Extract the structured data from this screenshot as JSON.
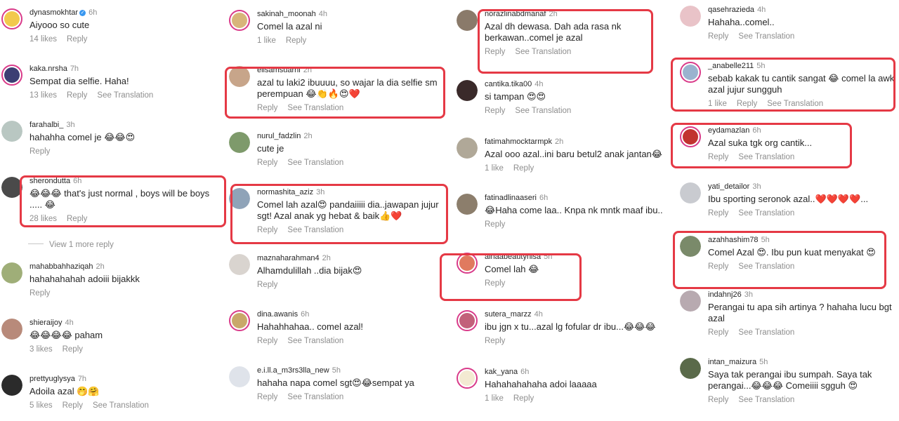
{
  "ui": {
    "reply": "Reply",
    "see_translation": "See Translation",
    "view_more": "View 1 more reply"
  },
  "columns": [
    [
      {
        "user": "dynasmokhtar",
        "time": "6h",
        "verified": true,
        "text": "Aiyooo so cute",
        "likes": "14 likes",
        "translate": false,
        "ring": true,
        "avatar": "#f2c94c"
      },
      {
        "user": "kaka.nrsha",
        "time": "7h",
        "text": "Sempat dia selfie. Haha!",
        "likes": "13 likes",
        "translate": true,
        "ring": true,
        "avatar": "#3c3f73"
      },
      {
        "user": "farahalbi_",
        "time": "3h",
        "text": "hahahha comel je 😂😂😍",
        "likes": "",
        "translate": false,
        "ring": false,
        "avatar": "#b9c7c2"
      },
      {
        "user": "sherondutta",
        "time": "6h",
        "text": "😂😂😂 that's just normal , boys will be boys\n..... 😂",
        "likes": "28 likes",
        "translate": false,
        "ring": false,
        "avatar": "#4a4a4a",
        "highlight": true
      },
      {
        "user": "mahabbahhaziqah",
        "time": "2h",
        "text": "hahahahahah adoiii bijakkk",
        "likes": "",
        "translate": false,
        "ring": false,
        "avatar": "#9fae78"
      },
      {
        "user": "shieraijoy",
        "time": "4h",
        "text": "😂😂😂😂 paham",
        "likes": "3 likes",
        "translate": false,
        "ring": false,
        "avatar": "#b88a7a"
      },
      {
        "user": "prettyuglysya",
        "time": "7h",
        "text": "Adoila azal 🤭🤗",
        "likes": "5 likes",
        "translate": true,
        "ring": false,
        "avatar": "#2b2b2b"
      }
    ],
    [
      {
        "user": "sakinah_moonah",
        "time": "4h",
        "text": "Comel la azal ni",
        "likes": "1 like",
        "translate": false,
        "ring": true,
        "avatar": "#d8b57a"
      },
      {
        "user": "elisamsuarni",
        "time": "2h",
        "text": "azal tu laki2 ibuuuu, so wajar la dia selfie sm\nperempuan 😂👏🔥😍❤️",
        "likes": "",
        "translate": true,
        "ring": false,
        "avatar": "#c7a58a",
        "highlight": true
      },
      {
        "user": "nurul_fadzlin",
        "time": "2h",
        "text": "cute je",
        "likes": "",
        "translate": true,
        "ring": false,
        "avatar": "#7e9a6b"
      },
      {
        "user": "normashita_aziz",
        "time": "3h",
        "text": "Comel lah azal😍 pandaiiiii dia..jawapan jujur\nsgt! Azal anak yg hebat & baik👍❤️",
        "likes": "",
        "translate": true,
        "ring": false,
        "avatar": "#8fa3b8",
        "highlight": true
      },
      {
        "user": "maznaharahman4",
        "time": "2h",
        "text": "Alhamdulillah ..dia bijak😍",
        "likes": "",
        "translate": false,
        "ring": false,
        "avatar": "#d9d4cf"
      },
      {
        "user": "dina.awanis",
        "time": "6h",
        "text": "Hahahhahaa.. comel azal!",
        "likes": "",
        "translate": true,
        "ring": true,
        "avatar": "#c9a86a"
      },
      {
        "user": "e.i.ll.a_m3rs3lla_new",
        "time": "5h",
        "text": "hahaha napa comel sgt😍😂sempat ya",
        "likes": "",
        "translate": true,
        "ring": false,
        "avatar": "#dfe3ea"
      }
    ],
    [
      {
        "user": "norazlinabdmanaf",
        "time": "2h",
        "text": "Azal dh dewasa. Dah ada rasa nk\nberkawan..comel je azal",
        "likes": "",
        "translate": true,
        "ring": false,
        "avatar": "#8a7a6a",
        "highlight": true
      },
      {
        "user": "cantika.tika00",
        "time": "4h",
        "text": "si tampan 😍😍",
        "likes": "",
        "translate": true,
        "ring": false,
        "avatar": "#3a2a2a"
      },
      {
        "user": "fatimahmocktarmpk",
        "time": "2h",
        "text": "Azal ooo azal..ini baru betul2 anak jantan😂",
        "likes": "1 like",
        "translate": false,
        "ring": false,
        "avatar": "#b0a898"
      },
      {
        "user": "fatinadlinaaseri",
        "time": "6h",
        "text": "😂Haha come laa.. Knpa nk mntk maaf ibu..",
        "likes": "",
        "translate": false,
        "ring": false,
        "avatar": "#8c7e6c"
      },
      {
        "user": "ainaabeautynisa",
        "time": "5h",
        "text": "Comel lah 😂",
        "likes": "",
        "translate": false,
        "ring": true,
        "avatar": "#e07a5f",
        "highlight": true
      },
      {
        "user": "sutera_marzz",
        "time": "4h",
        "text": "ibu jgn x tu...azal lg fofular dr ibu...😂😂😂",
        "likes": "",
        "translate": false,
        "ring": true,
        "avatar": "#c2607a"
      },
      {
        "user": "kak_yana",
        "time": "6h",
        "text": "Hahahahahaha adoi laaaaa",
        "likes": "1 like",
        "translate": false,
        "ring": true,
        "avatar": "#f3ead2"
      }
    ],
    [
      {
        "user": "qasehrazieda",
        "time": "4h",
        "text": "Hahaha..comel..",
        "likes": "",
        "translate": true,
        "ring": false,
        "avatar": "#e9c3c8"
      },
      {
        "user": "_anabelle211",
        "time": "5h",
        "text": "sebab kakak tu cantik sangat 😂 comel la awk\nazal jujur sungguh",
        "likes": "1 like",
        "translate": true,
        "ring": true,
        "avatar": "#9ab3cf",
        "highlight": true
      },
      {
        "user": "eydamazlan",
        "time": "6h",
        "text": "Azal suka tgk org cantik...",
        "likes": "",
        "translate": true,
        "ring": true,
        "avatar": "#c1332f",
        "highlight": true
      },
      {
        "user": "yati_detailor",
        "time": "3h",
        "text": "Ibu sporting seronok azal..❤️❤️❤️❤️...",
        "likes": "",
        "translate": true,
        "ring": false,
        "avatar": "#c9cbd0"
      },
      {
        "user": "azahhashim78",
        "time": "5h",
        "text": "Comel Azal 😍. Ibu pun kuat menyakat 😍",
        "likes": "",
        "translate": true,
        "ring": false,
        "avatar": "#7a8a6a",
        "highlight": true
      },
      {
        "user": "indahnj26",
        "time": "3h",
        "text": "Perangai tu apa sih artinya ? hahaha lucu bgt\nazal",
        "likes": "",
        "translate": true,
        "ring": false,
        "avatar": "#b8aab0"
      },
      {
        "user": "intan_maizura",
        "time": "5h",
        "text": "Saya tak perangai ibu sumpah. Saya tak\nperangai...😂😂😂 Comeiiii sgguh 😍",
        "likes": "",
        "translate": true,
        "ring": false,
        "avatar": "#5a6a4a"
      }
    ]
  ]
}
